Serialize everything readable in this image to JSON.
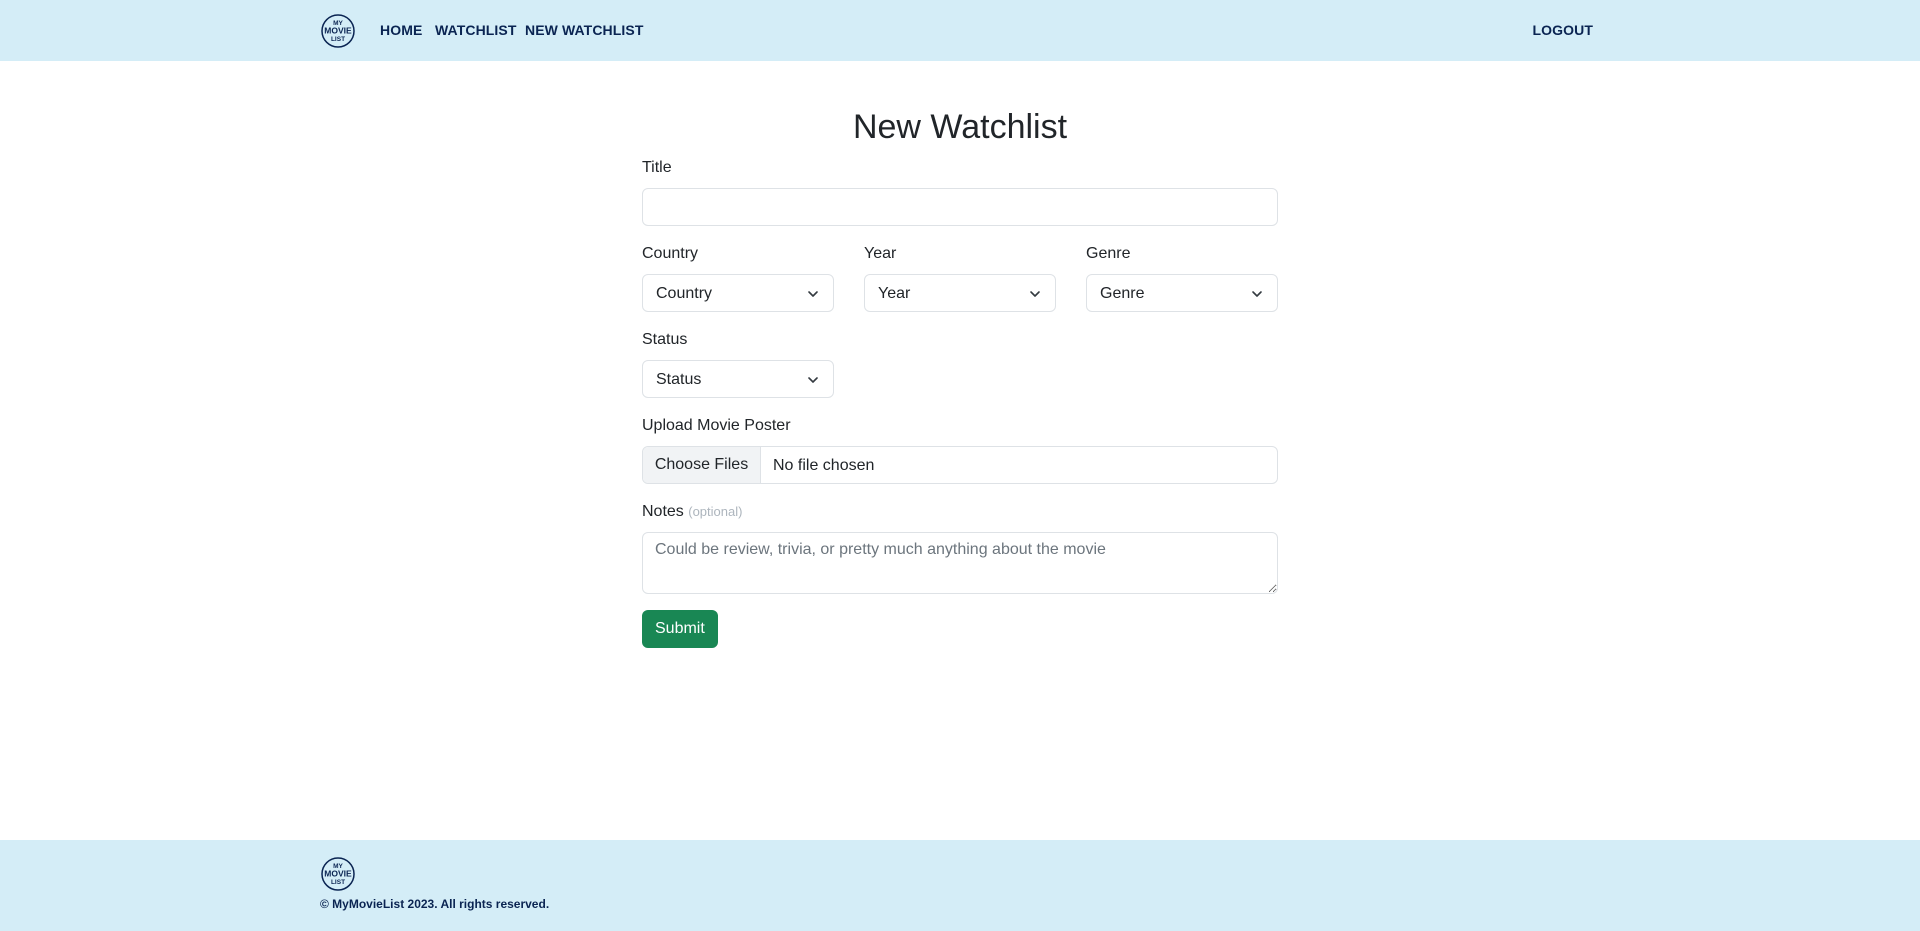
{
  "brand": {
    "logo_lines": [
      "MY",
      "MOVIE",
      "LIST"
    ],
    "color": "#0a2452"
  },
  "nav": {
    "home": "HOME",
    "watchlist": "WATCHLIST",
    "new_watchlist": "NEW WATCHLIST",
    "logout": "LOGOUT"
  },
  "form": {
    "title": "New Watchlist",
    "title_label": "Title",
    "title_value": "",
    "country_label": "Country",
    "country_selected": "Country",
    "year_label": "Year",
    "year_selected": "Year",
    "genre_label": "Genre",
    "genre_selected": "Genre",
    "status_label": "Status",
    "status_selected": "Status",
    "poster_label": "Upload Movie Poster",
    "choose_files": "Choose Files",
    "file_status": "No file chosen",
    "notes_label": "Notes",
    "notes_optional": "(optional)",
    "notes_placeholder": "Could be review, trivia, or pretty much anything about the movie",
    "submit": "Submit"
  },
  "footer": {
    "copyright": "© MyMovieList 2023. All rights reserved."
  },
  "colors": {
    "header_bg": "#d4edf7",
    "nav_text": "#0a2452",
    "submit_bg": "#198754"
  }
}
